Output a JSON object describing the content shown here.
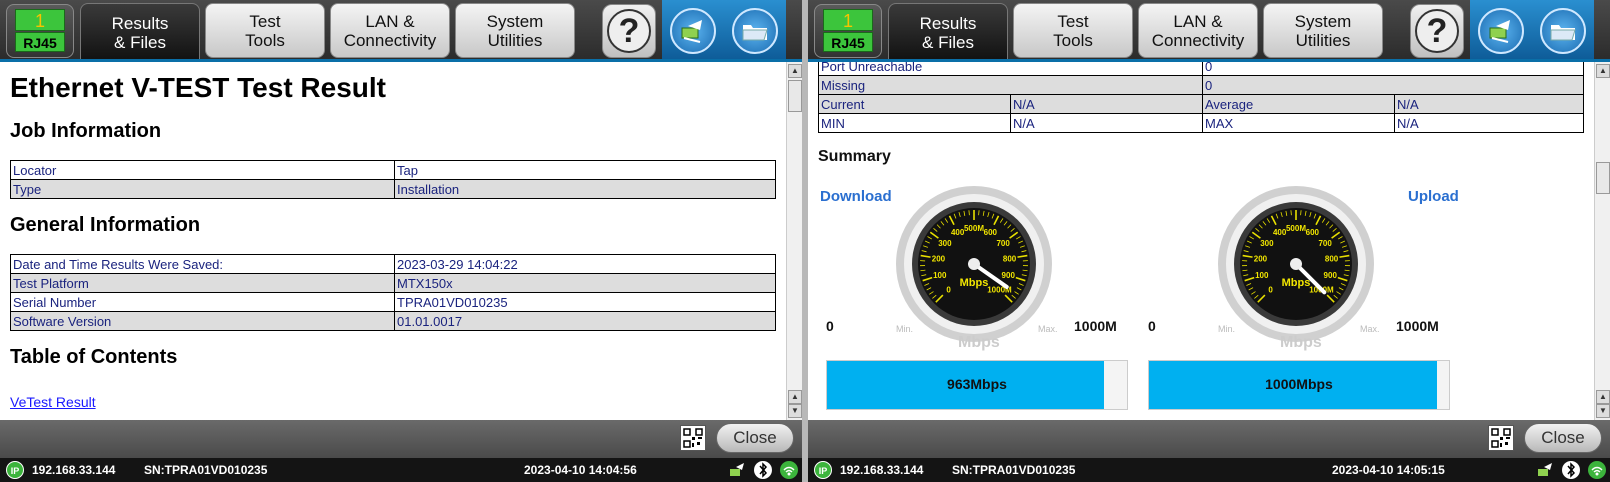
{
  "panels": [
    {
      "port": {
        "number": "1",
        "label": "RJ45"
      },
      "tabs": [
        "Results\n& Files",
        "Test\nTools",
        "LAN &\nConnectivity",
        "System\nUtilities"
      ],
      "help": "?",
      "close_label": "Close",
      "status": {
        "ip_badge": "IP",
        "ip": "192.168.33.144",
        "sn": "SN:TPRA01VD010235",
        "datetime": "2023-04-10  14:04:56"
      }
    },
    {
      "port": {
        "number": "1",
        "label": "RJ45"
      },
      "tabs": [
        "Results\n& Files",
        "Test\nTools",
        "LAN &\nConnectivity",
        "System\nUtilities"
      ],
      "help": "?",
      "close_label": "Close",
      "status": {
        "ip_badge": "IP",
        "ip": "192.168.33.144",
        "sn": "SN:TPRA01VD010235",
        "datetime": "2023-04-10  14:05:15"
      }
    }
  ],
  "report": {
    "title": "Ethernet V-TEST Test Result",
    "job_heading": "Job Information",
    "job_rows": [
      [
        "Locator",
        "Tap"
      ],
      [
        "Type",
        "Installation"
      ]
    ],
    "general_heading": "General Information",
    "general_rows": [
      [
        "Date and Time Results Were Saved:",
        "2023-03-29 14:04:22"
      ],
      [
        "Test Platform",
        "MTX150x"
      ],
      [
        "Serial Number",
        "TPRA01VD010235"
      ],
      [
        "Software Version",
        "01.01.0017"
      ]
    ],
    "toc_heading": "Table of Contents",
    "toc_link": "VeTest Result"
  },
  "detail": {
    "rows2": [
      [
        "Port Unreachable",
        "0"
      ],
      [
        "Missing",
        "0"
      ]
    ],
    "rows4": [
      [
        "Current",
        "N/A",
        "Average",
        "N/A"
      ],
      [
        "MIN",
        "N/A",
        "MAX",
        "N/A"
      ]
    ],
    "summary_heading": "Summary",
    "download_label": "Download",
    "upload_label": "Upload",
    "gauge_ticks": [
      "0",
      "100",
      "200",
      "300",
      "400",
      "500M",
      "600",
      "700",
      "800",
      "900",
      "1000M"
    ],
    "gauge_unit": "Mbps",
    "scale_min": "0",
    "scale_max": "1000M",
    "min_label": "Min.",
    "max_label": "Max.",
    "unit_label": "Mbps",
    "download_value": "963Mbps",
    "upload_value": "1000Mbps",
    "download_level": 0.963,
    "upload_level": 1.0
  }
}
